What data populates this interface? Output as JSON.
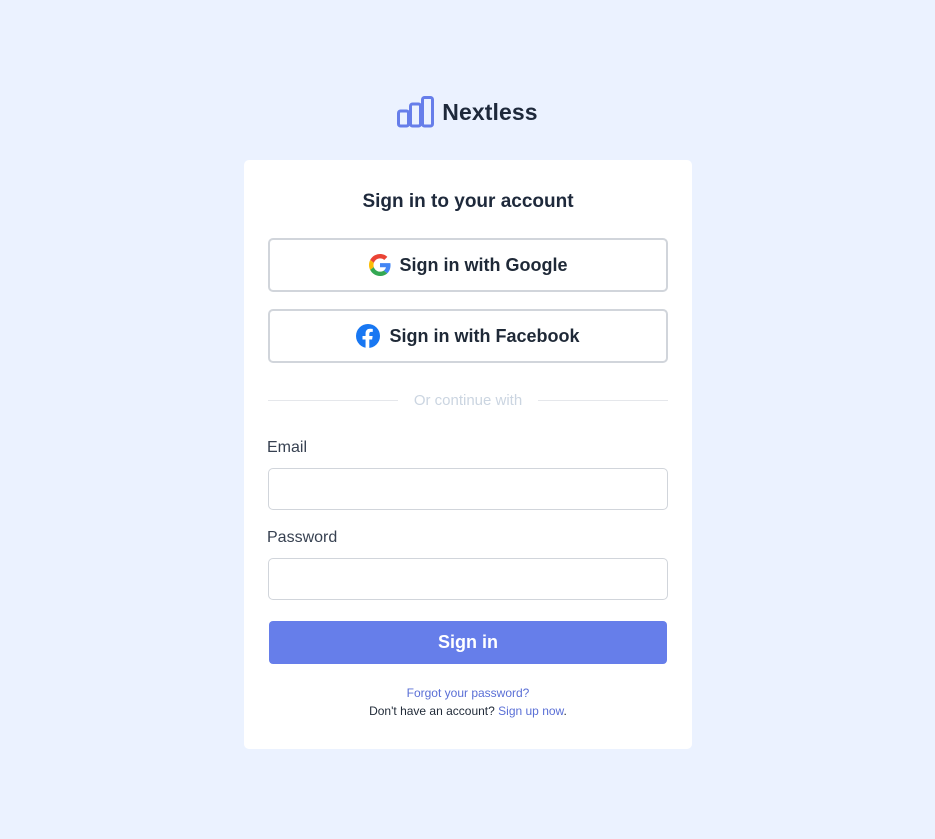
{
  "brand": {
    "name": "Nextless",
    "logo_icon": "bar-chart-icon",
    "accent_color": "#667eea"
  },
  "card": {
    "title": "Sign in to your account",
    "google_button": {
      "label": "Sign in with Google",
      "icon": "google-icon"
    },
    "facebook_button": {
      "label": "Sign in with Facebook",
      "icon": "facebook-icon"
    },
    "divider_text": "Or continue with",
    "email": {
      "label": "Email",
      "value": "",
      "placeholder": ""
    },
    "password": {
      "label": "Password",
      "value": "",
      "placeholder": ""
    },
    "submit_label": "Sign in",
    "forgot_password": "Forgot your password?",
    "signup_prompt": "Don't have an account?",
    "signup_link": "Sign up now",
    "signup_suffix": "."
  }
}
